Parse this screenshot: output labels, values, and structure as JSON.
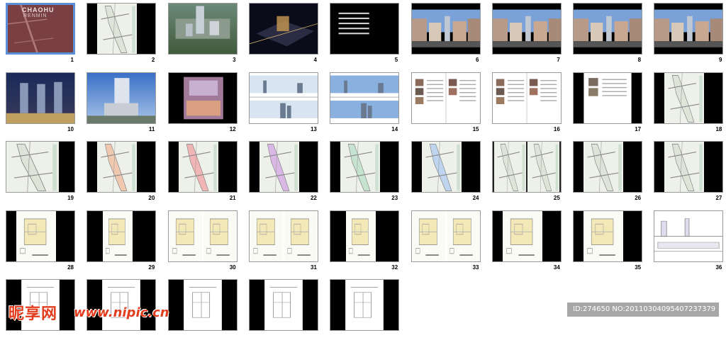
{
  "thumbnails": [
    {
      "number": "1",
      "kind": "cover",
      "selected": true,
      "cover_title": "CHAOHU",
      "cover_sub": "RENMIN"
    },
    {
      "number": "2",
      "kind": "plan_right_black"
    },
    {
      "number": "3",
      "kind": "aerial_day"
    },
    {
      "number": "4",
      "kind": "aerial_night"
    },
    {
      "number": "5",
      "kind": "text_black"
    },
    {
      "number": "6",
      "kind": "street"
    },
    {
      "number": "7",
      "kind": "street"
    },
    {
      "number": "8",
      "kind": "street"
    },
    {
      "number": "9",
      "kind": "street"
    },
    {
      "number": "10",
      "kind": "towers_night"
    },
    {
      "number": "11",
      "kind": "tower_day"
    },
    {
      "number": "12",
      "kind": "interior"
    },
    {
      "number": "13",
      "kind": "elevation"
    },
    {
      "number": "14",
      "kind": "elevation_color"
    },
    {
      "number": "15",
      "kind": "spread_photos"
    },
    {
      "number": "16",
      "kind": "spread_photos"
    },
    {
      "number": "17",
      "kind": "page_center"
    },
    {
      "number": "18",
      "kind": "plan_right_black"
    },
    {
      "number": "19",
      "kind": "plan_single"
    },
    {
      "number": "20",
      "kind": "plan_color"
    },
    {
      "number": "21",
      "kind": "plan_red"
    },
    {
      "number": "22",
      "kind": "plan_purple"
    },
    {
      "number": "23",
      "kind": "plan_green"
    },
    {
      "number": "24",
      "kind": "plan_blue"
    },
    {
      "number": "25",
      "kind": "spread_plans"
    },
    {
      "number": "26",
      "kind": "plan_right_black"
    },
    {
      "number": "27",
      "kind": "plan_right_black"
    },
    {
      "number": "28",
      "kind": "floor_plan"
    },
    {
      "number": "29",
      "kind": "floor_plan_narrow"
    },
    {
      "number": "30",
      "kind": "spread_floor"
    },
    {
      "number": "31",
      "kind": "spread_floor"
    },
    {
      "number": "32",
      "kind": "floor_plan_narrow"
    },
    {
      "number": "33",
      "kind": "spread_floor"
    },
    {
      "number": "34",
      "kind": "floor_plan"
    },
    {
      "number": "35",
      "kind": "floor_plan"
    },
    {
      "number": "36",
      "kind": "section_white"
    },
    {
      "number": "",
      "kind": "drawing_partial"
    },
    {
      "number": "",
      "kind": "drawing_partial"
    },
    {
      "number": "",
      "kind": "drawing_partial"
    },
    {
      "number": "",
      "kind": "drawing_partial"
    },
    {
      "number": "",
      "kind": "drawing_partial"
    }
  ],
  "watermark": {
    "logo_text": "昵享网",
    "url_text": "www.nipic.cn",
    "id_text": "ID:274650 NO:20110304095407237379"
  },
  "colors": {
    "selection": "#5b8ed6",
    "watermark_red": "#e23d1f"
  }
}
